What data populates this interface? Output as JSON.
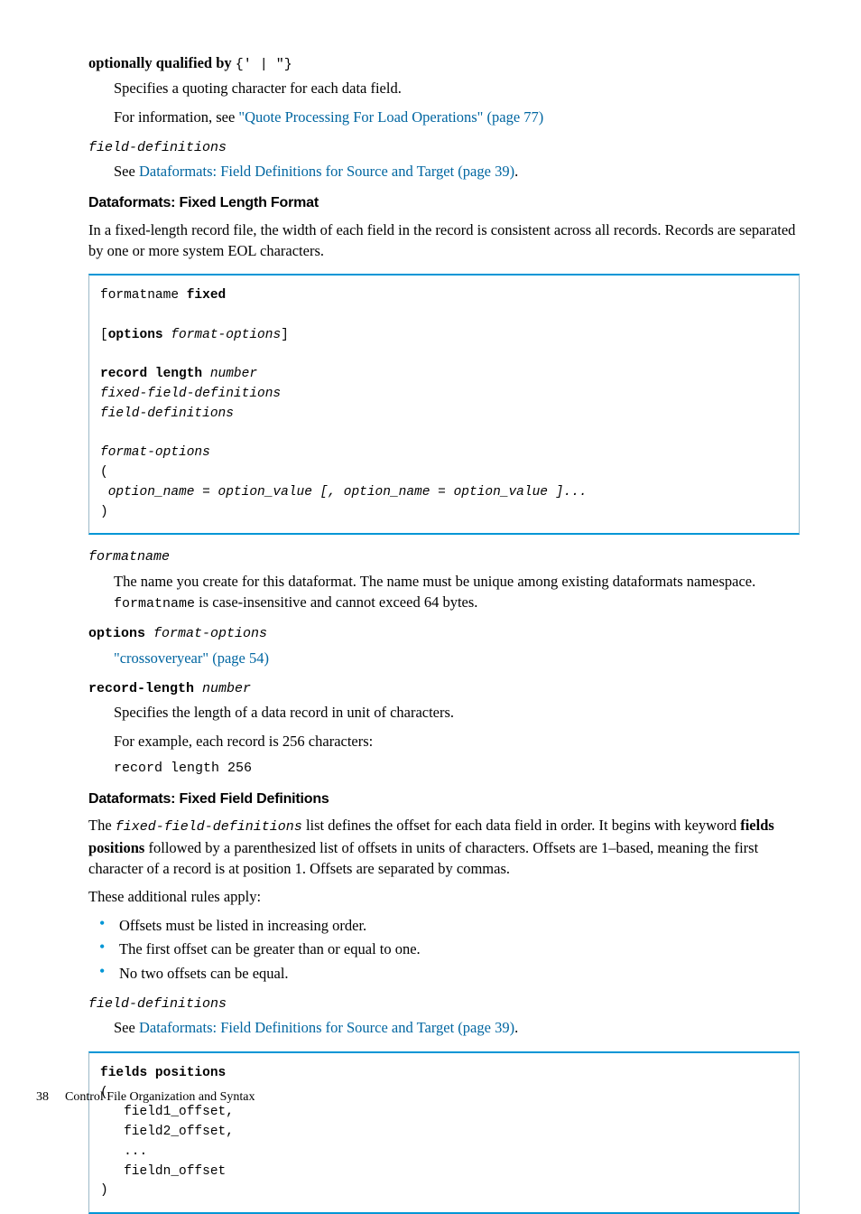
{
  "defs1": {
    "term1": {
      "label": "optionally qualified by",
      "code": "{'  |  \"}"
    },
    "def1a": "Specifies a quoting character for each data field.",
    "def1b_pre": "For information, see ",
    "def1b_link": "\"Quote Processing For Load Operations\" (page 77)",
    "term2": "field-definitions",
    "def2_pre": "See ",
    "def2_link": "Dataformats: Field Definitions for Source and Target (page 39)",
    "def2_post": "."
  },
  "heading1": "Dataformats: Fixed Length Format",
  "para1": "In a fixed-length record file, the width of each field in the record is consistent across all records. Records are separated by one or more system EOL characters.",
  "code1_l1a": "formatname ",
  "code1_l1b": "fixed",
  "code1_l3a": "[",
  "code1_l3b": "options",
  "code1_l3c": " format-options",
  "code1_l3d": "]",
  "code1_l5a": "record length",
  "code1_l5b": " number",
  "code1_l6": "fixed-field-definitions",
  "code1_l7": "field-definitions",
  "code1_l9": "format-options",
  "code1_l10": "(",
  "code1_l11": " option_name = option_value [, option_name = option_value ]...",
  "code1_l12": ")",
  "defs2": {
    "term1": "formatname",
    "def1a": "The name you create for this dataformat. The name must be unique among existing dataformats namespace. ",
    "def1b_code": "formatname",
    "def1c": " is case-insensitive and cannot exceed 64 bytes.",
    "term2a": "options",
    "term2b": " format-options",
    "def2_link": "\"crossoveryear\" (page 54)",
    "term3a": "record-length",
    "term3b": " number",
    "def3a": "Specifies the length of a data record in unit of characters.",
    "def3b": "For example, each record is 256 characters:",
    "def3c": "record length 256"
  },
  "heading2": "Dataformats: Fixed Field Definitions",
  "para2_pre": "The ",
  "para2_code": "fixed-field-definitions",
  "para2_mid": " list defines the offset for each data field in order. It begins with keyword ",
  "para2_bold": "fields positions",
  "para2_post": " followed by a parenthesized list of offsets in units of characters. Offsets are 1–based, meaning the first character of a record is at position 1. Offsets are separated by commas.",
  "para3": "These additional rules apply:",
  "bullets": [
    "Offsets must be listed in increasing order.",
    "The first offset can be greater than or equal to one.",
    "No two offsets can be equal."
  ],
  "defs3": {
    "term": "field-definitions",
    "def_pre": "See ",
    "def_link": "Dataformats: Field Definitions for Source and Target (page 39)",
    "def_post": "."
  },
  "code2_l1": "fields positions",
  "code2_l2": "(",
  "code2_l3": "   field1_offset,",
  "code2_l4": "   field2_offset,",
  "code2_l5": "   ...",
  "code2_l6": "   fieldn_offset",
  "code2_l7": ")",
  "footer_page": "38",
  "footer_text": "Control File Organization and Syntax"
}
